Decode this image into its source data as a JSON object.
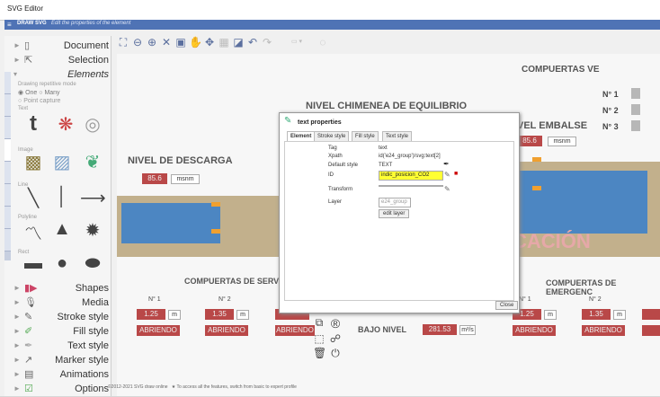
{
  "window_title": "SVG Editor",
  "menubar": {
    "logo": "DRAW SVG",
    "subtitle": "Edit the properties of the element"
  },
  "left_panel": {
    "document_label": "Document",
    "selection_label": "Selection",
    "elements_label": "Elements",
    "drawing_mode": "Drawing repetitive mode",
    "opt_one": "One",
    "opt_many": "Many",
    "opt_point_capture": "Point capture",
    "text_section": "Text",
    "image_section": "Image",
    "line_section": "Line",
    "polyline_section": "Polyline",
    "rect_section": "Rect",
    "shapes_label": "Shapes",
    "media_label": "Media",
    "stroke_style_label": "Stroke style",
    "fill_style_label": "Fill style",
    "text_style_label": "Text style",
    "marker_style_label": "Marker style",
    "animations_label": "Animations",
    "options_label": "Options"
  },
  "canvas": {
    "compuertas_ve": "COMPUERTAS VE",
    "nivel_chimenea": "NIVEL CHIMENEA DE EQUILIBRIO",
    "nivel_embalse": "VEL EMBALSE",
    "nivel_descarga": "NIVEL DE DESCARGA",
    "descarga_val": "85.6",
    "embalse_val": "85.6",
    "unit_msnm": "msnm",
    "gate_n1": "N° 1",
    "gate_n2": "N° 2",
    "gate_n3": "N° 3",
    "cacion": "CACIÓN",
    "servicio_title": "COMPUERTAS DE SERVICIO",
    "emergencia_title": "COMPUERTAS DE EMERGENC",
    "s_n1": "N° 1",
    "s_n2": "N° 2",
    "s_v1": "1.25",
    "s_v2": "1.35",
    "unit_m": "m",
    "abriendo": "ABRIENDO",
    "bajo_nivel": "BAJO NIVEL",
    "bajo_val": "281.53",
    "unit_m3s": "m³/s",
    "e_n1": "N° 1",
    "e_n2": "N° 2",
    "e_v1": "1.25",
    "e_v2": "1.35"
  },
  "modal": {
    "title": "text properties",
    "tabs": [
      "Element",
      "Stroke style",
      "Fill style",
      "Text style"
    ],
    "tag_k": "Tag",
    "tag_v": "text",
    "xpath_k": "Xpath",
    "xpath_v": "id('e24_group')/svg:text[2]",
    "default_style_k": "Default style",
    "default_style_v": "TEXT",
    "id_k": "ID",
    "id_v": "indic_posicion_CO2",
    "transform_k": "Transform",
    "transform_v": "",
    "layer_k": "Layer",
    "layer_v": "e24_group",
    "edit_layer": "edit layer",
    "close": "Close"
  },
  "footer": {
    "copyright": "©2012-2021 SVG draw online",
    "tip": "To access all the features, switch from basic to expert profile"
  },
  "colors": {
    "accent": "#4f73b5",
    "alarm_red": "#b94848",
    "water": "#4c86c2",
    "yellow_highlight": "#ffff33"
  }
}
